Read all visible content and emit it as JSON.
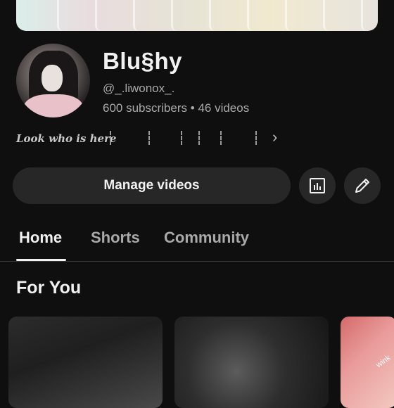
{
  "channel": {
    "name": "Blu§hy",
    "handle": "@_.liwonox_.",
    "subscribers": "600 subscribers",
    "separator": "•",
    "videos": "46 videos",
    "bio_text": "Look who is here",
    "bio_more_chevron": "›"
  },
  "actions": {
    "manage_videos_label": "Manage videos",
    "analytics_icon": "bar-chart-icon",
    "edit_icon": "pencil-icon"
  },
  "tabs": [
    {
      "label": "Home",
      "active": true
    },
    {
      "label": "Shorts",
      "active": false
    },
    {
      "label": "Community",
      "active": false
    }
  ],
  "section": {
    "title": "For You"
  },
  "thumbnails": [
    {
      "overlay_text": ""
    },
    {
      "overlay_text": ""
    },
    {
      "overlay_text": "wink"
    }
  ],
  "colors": {
    "background": "#0f0f0f",
    "button": "#272727",
    "text_primary": "#f1f1f1",
    "text_secondary": "#aaaaaa"
  }
}
